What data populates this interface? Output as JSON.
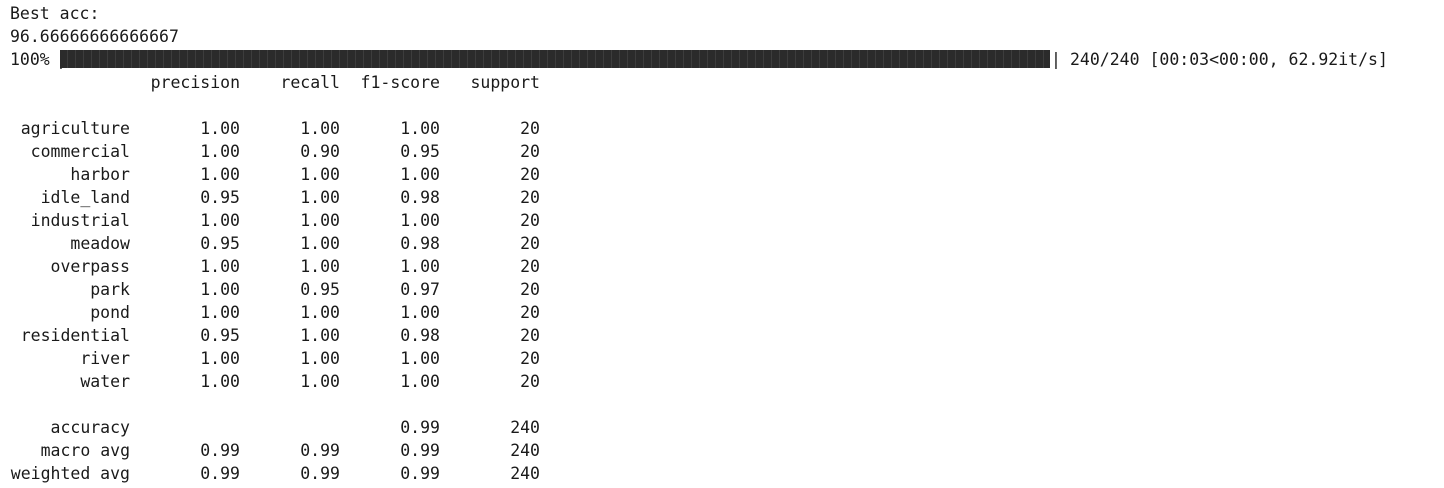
{
  "best_acc": {
    "label": "Best acc:",
    "value": "96.66666666666667"
  },
  "progress": {
    "percent_label": "100%",
    "open_pipe": "|",
    "close_pipe": "|",
    "fraction": 1.0,
    "stats": "240/240 [00:03<00:00, 62.92it/s]"
  },
  "report": {
    "headers": [
      "",
      "precision",
      "recall",
      "f1-score",
      "support"
    ],
    "classes": [
      {
        "label": "agriculture",
        "precision": "1.00",
        "recall": "1.00",
        "f1": "1.00",
        "support": "20"
      },
      {
        "label": "commercial",
        "precision": "1.00",
        "recall": "0.90",
        "f1": "0.95",
        "support": "20"
      },
      {
        "label": "harbor",
        "precision": "1.00",
        "recall": "1.00",
        "f1": "1.00",
        "support": "20"
      },
      {
        "label": "idle_land",
        "precision": "0.95",
        "recall": "1.00",
        "f1": "0.98",
        "support": "20"
      },
      {
        "label": "industrial",
        "precision": "1.00",
        "recall": "1.00",
        "f1": "1.00",
        "support": "20"
      },
      {
        "label": "meadow",
        "precision": "0.95",
        "recall": "1.00",
        "f1": "0.98",
        "support": "20"
      },
      {
        "label": "overpass",
        "precision": "1.00",
        "recall": "1.00",
        "f1": "1.00",
        "support": "20"
      },
      {
        "label": "park",
        "precision": "1.00",
        "recall": "0.95",
        "f1": "0.97",
        "support": "20"
      },
      {
        "label": "pond",
        "precision": "1.00",
        "recall": "1.00",
        "f1": "1.00",
        "support": "20"
      },
      {
        "label": "residential",
        "precision": "0.95",
        "recall": "1.00",
        "f1": "0.98",
        "support": "20"
      },
      {
        "label": "river",
        "precision": "1.00",
        "recall": "1.00",
        "f1": "1.00",
        "support": "20"
      },
      {
        "label": "water",
        "precision": "1.00",
        "recall": "1.00",
        "f1": "1.00",
        "support": "20"
      }
    ],
    "summary": [
      {
        "label": "accuracy",
        "precision": "",
        "recall": "",
        "f1": "0.99",
        "support": "240"
      },
      {
        "label": "macro avg",
        "precision": "0.99",
        "recall": "0.99",
        "f1": "0.99",
        "support": "240"
      },
      {
        "label": "weighted avg",
        "precision": "0.99",
        "recall": "0.99",
        "f1": "0.99",
        "support": "240"
      }
    ]
  }
}
